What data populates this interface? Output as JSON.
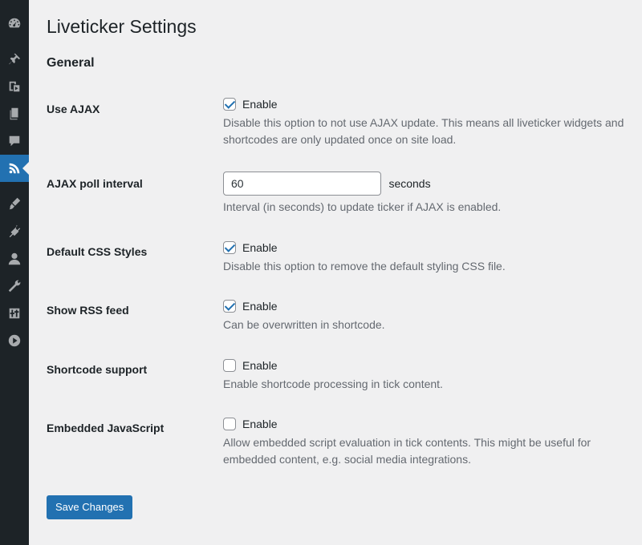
{
  "sidebar": {
    "items": [
      {
        "icon": "dashboard-icon"
      },
      {
        "icon": "pin-icon"
      },
      {
        "icon": "media-icon"
      },
      {
        "icon": "pages-icon"
      },
      {
        "icon": "comments-icon"
      },
      {
        "icon": "rss-icon",
        "active": true
      },
      {
        "icon": "appearance-icon"
      },
      {
        "icon": "plugins-icon"
      },
      {
        "icon": "users-icon"
      },
      {
        "icon": "tools-icon"
      },
      {
        "icon": "settings-icon"
      },
      {
        "icon": "play-icon"
      }
    ]
  },
  "page": {
    "title": "Liveticker Settings",
    "section": "General"
  },
  "settings": {
    "use_ajax": {
      "label": "Use AJAX",
      "checkbox_label": "Enable",
      "checked": true,
      "description": "Disable this option to not use AJAX update. This means all liveticker widgets and shortcodes are only updated once on site load."
    },
    "poll_interval": {
      "label": "AJAX poll interval",
      "value": "60",
      "unit": "seconds",
      "description": "Interval (in seconds) to update ticker if AJAX is enabled."
    },
    "default_css": {
      "label": "Default CSS Styles",
      "checkbox_label": "Enable",
      "checked": true,
      "description": "Disable this option to remove the default styling CSS file."
    },
    "show_rss": {
      "label": "Show RSS feed",
      "checkbox_label": "Enable",
      "checked": true,
      "description": "Can be overwritten in shortcode."
    },
    "shortcode_support": {
      "label": "Shortcode support",
      "checkbox_label": "Enable",
      "checked": false,
      "description": "Enable shortcode processing in tick content."
    },
    "embedded_js": {
      "label": "Embedded JavaScript",
      "checkbox_label": "Enable",
      "checked": false,
      "description": "Allow embedded script evaluation in tick contents. This might be useful for embedded content, e.g. social media integrations."
    }
  },
  "actions": {
    "save_label": "Save Changes"
  },
  "colors": {
    "sidebar_bg": "#1d2327",
    "accent": "#2271b1",
    "page_bg": "#f0f0f1",
    "description_text": "#646970"
  }
}
